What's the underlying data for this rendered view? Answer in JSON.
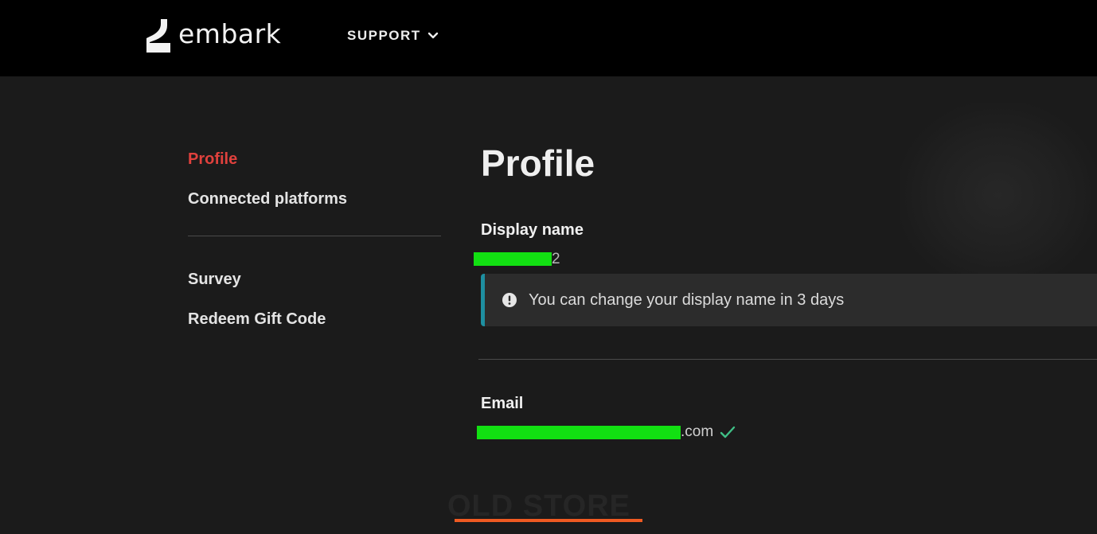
{
  "header": {
    "logo_text": "embark",
    "support_label": "SUPPORT",
    "support_icon": "chevron-down-icon"
  },
  "sidebar": {
    "items": [
      {
        "label": "Profile",
        "active": true
      },
      {
        "label": "Connected platforms",
        "active": false
      }
    ],
    "secondary_items": [
      {
        "label": "Survey"
      },
      {
        "label": "Redeem Gift Code"
      }
    ]
  },
  "main": {
    "title": "Profile",
    "display_name": {
      "label": "Display name",
      "value_visible_suffix": "2"
    },
    "notice": {
      "icon": "alert-circle-icon",
      "text": "You can change your display name in 3 days"
    },
    "email": {
      "label": "Email",
      "value_visible_suffix": ".com",
      "verified_icon": "check-icon"
    }
  },
  "overlay": {
    "text": "OLD STORE"
  },
  "colors": {
    "header_bg": "#000000",
    "page_bg": "#1b1b1b",
    "active_link": "#e0413d",
    "notice_accent": "#1e8fa0",
    "verified_check": "#3fbf86",
    "underline_accent": "#ef5a22",
    "redaction": "#12e012"
  }
}
